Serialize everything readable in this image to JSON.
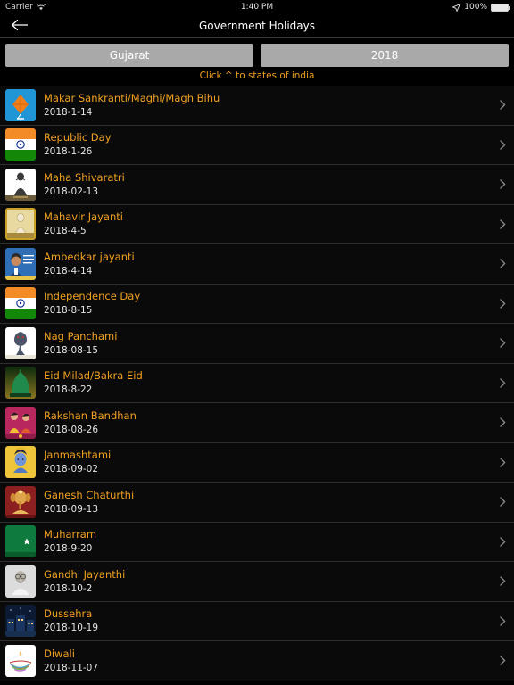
{
  "status_bar": {
    "carrier": "Carrier",
    "wifi_icon": "wifi-icon",
    "time": "1:40 PM",
    "location_icon": "location-arrow-icon",
    "battery_percent": "100%",
    "battery_icon": "battery-full-icon"
  },
  "nav": {
    "back_icon": "back-arrow-icon",
    "title": "Government Holidays"
  },
  "selectors": {
    "state": "Gujarat",
    "year": "2018"
  },
  "hint": "Click ^ to states of india",
  "colors": {
    "background": "#000000",
    "row_background": "#0a0a0a",
    "title_accent": "#f0a020",
    "date_text": "#e6e6e6",
    "selector_background": "#a9a9a9",
    "separator": "#2e2e2e",
    "chevron": "#8a8a8a"
  },
  "list": {
    "chevron_icon": "chevron-right-icon",
    "rows": [
      {
        "title": "Makar Sankranti/Maghi/Magh Bihu",
        "date": "2018-1-14",
        "icon": "kite-icon"
      },
      {
        "title": "Republic Day",
        "date": "2018-1-26",
        "icon": "india-flag-icon"
      },
      {
        "title": "Maha Shivaratri",
        "date": "2018-02-13",
        "icon": "shiva-icon"
      },
      {
        "title": "Mahavir Jayanti",
        "date": "2018-4-5",
        "icon": "mahavir-statue-icon"
      },
      {
        "title": "Ambedkar jayanti",
        "date": "2018-4-14",
        "icon": "ambedkar-portrait-icon"
      },
      {
        "title": "Independence Day",
        "date": "2018-8-15",
        "icon": "india-flag-icon"
      },
      {
        "title": "Nag Panchami",
        "date": "2018-08-15",
        "icon": "cobra-icon"
      },
      {
        "title": "Eid Milad/Bakra Eid",
        "date": "2018-8-22",
        "icon": "mosque-icon"
      },
      {
        "title": "Rakshan Bandhan",
        "date": "2018-08-26",
        "icon": "rakhi-siblings-icon"
      },
      {
        "title": "Janmashtami",
        "date": "2018-09-02",
        "icon": "krishna-icon"
      },
      {
        "title": "Ganesh Chaturthi",
        "date": "2018-09-13",
        "icon": "ganesh-icon"
      },
      {
        "title": "Muharram",
        "date": "2018-9-20",
        "icon": "crescent-flag-icon"
      },
      {
        "title": "Gandhi Jayanthi",
        "date": "2018-10-2",
        "icon": "gandhi-portrait-icon"
      },
      {
        "title": "Dussehra",
        "date": "2018-10-19",
        "icon": "ramlila-grounds-icon"
      },
      {
        "title": "Diwali",
        "date": "2018-11-07",
        "icon": "diya-lamp-icon"
      }
    ]
  }
}
